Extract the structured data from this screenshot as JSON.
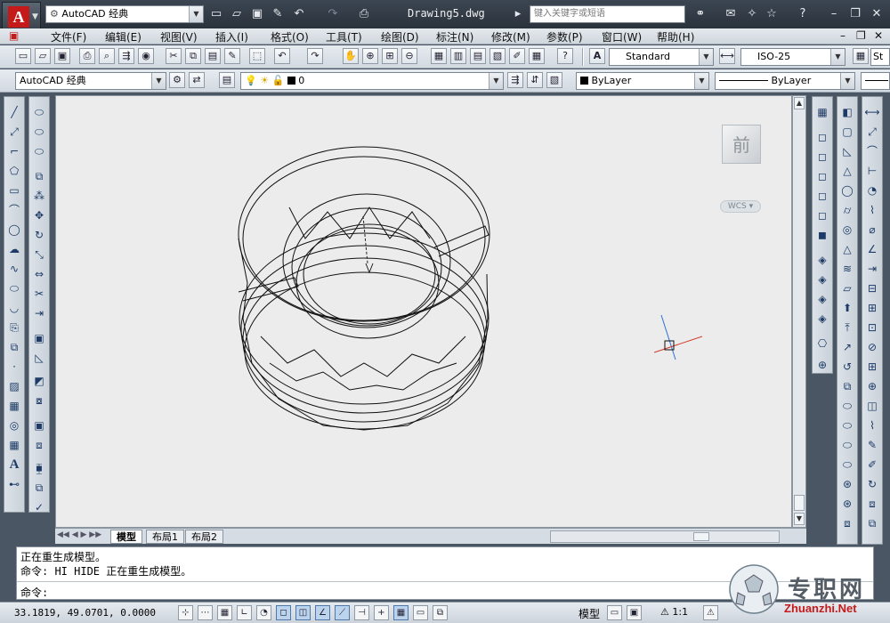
{
  "app": {
    "workspace": "AutoCAD 经典",
    "doc_title": "Drawing5.dwg",
    "search_placeholder": "键入关键字或短语"
  },
  "menu": [
    "文件(F)",
    "编辑(E)",
    "视图(V)",
    "插入(I)",
    "格式(O)",
    "工具(T)",
    "绘图(D)",
    "标注(N)",
    "修改(M)",
    "参数(P)",
    "窗口(W)",
    "帮助(H)"
  ],
  "styles": {
    "text_style": "Standard",
    "dim_style": "ISO-25",
    "table_style_partial": "St"
  },
  "layers": {
    "workspace_combo": "AutoCAD 经典",
    "current_layer": "0",
    "color": "ByLayer",
    "linetype": "ByLayer"
  },
  "viewcube": {
    "face_label": "前",
    "wcs_label": "WCS"
  },
  "layout_tabs": [
    "模型",
    "布局1",
    "布局2"
  ],
  "command": {
    "line1": "正在重生成模型。",
    "line2": "命令: HI HIDE 正在重生成模型。",
    "prompt": "命令:"
  },
  "status": {
    "coords": "33.1819, 49.0701, 0.0000",
    "space": "模型",
    "scale": "1:1"
  },
  "watermark": {
    "cn": "专职网",
    "url": "Zhuanzhi.Net"
  },
  "colors": {
    "accent_red": "#c41a1a",
    "canvas_bg": "#ececec",
    "ucs_red": "#d23c2c",
    "ucs_blue": "#2f6fd6"
  }
}
